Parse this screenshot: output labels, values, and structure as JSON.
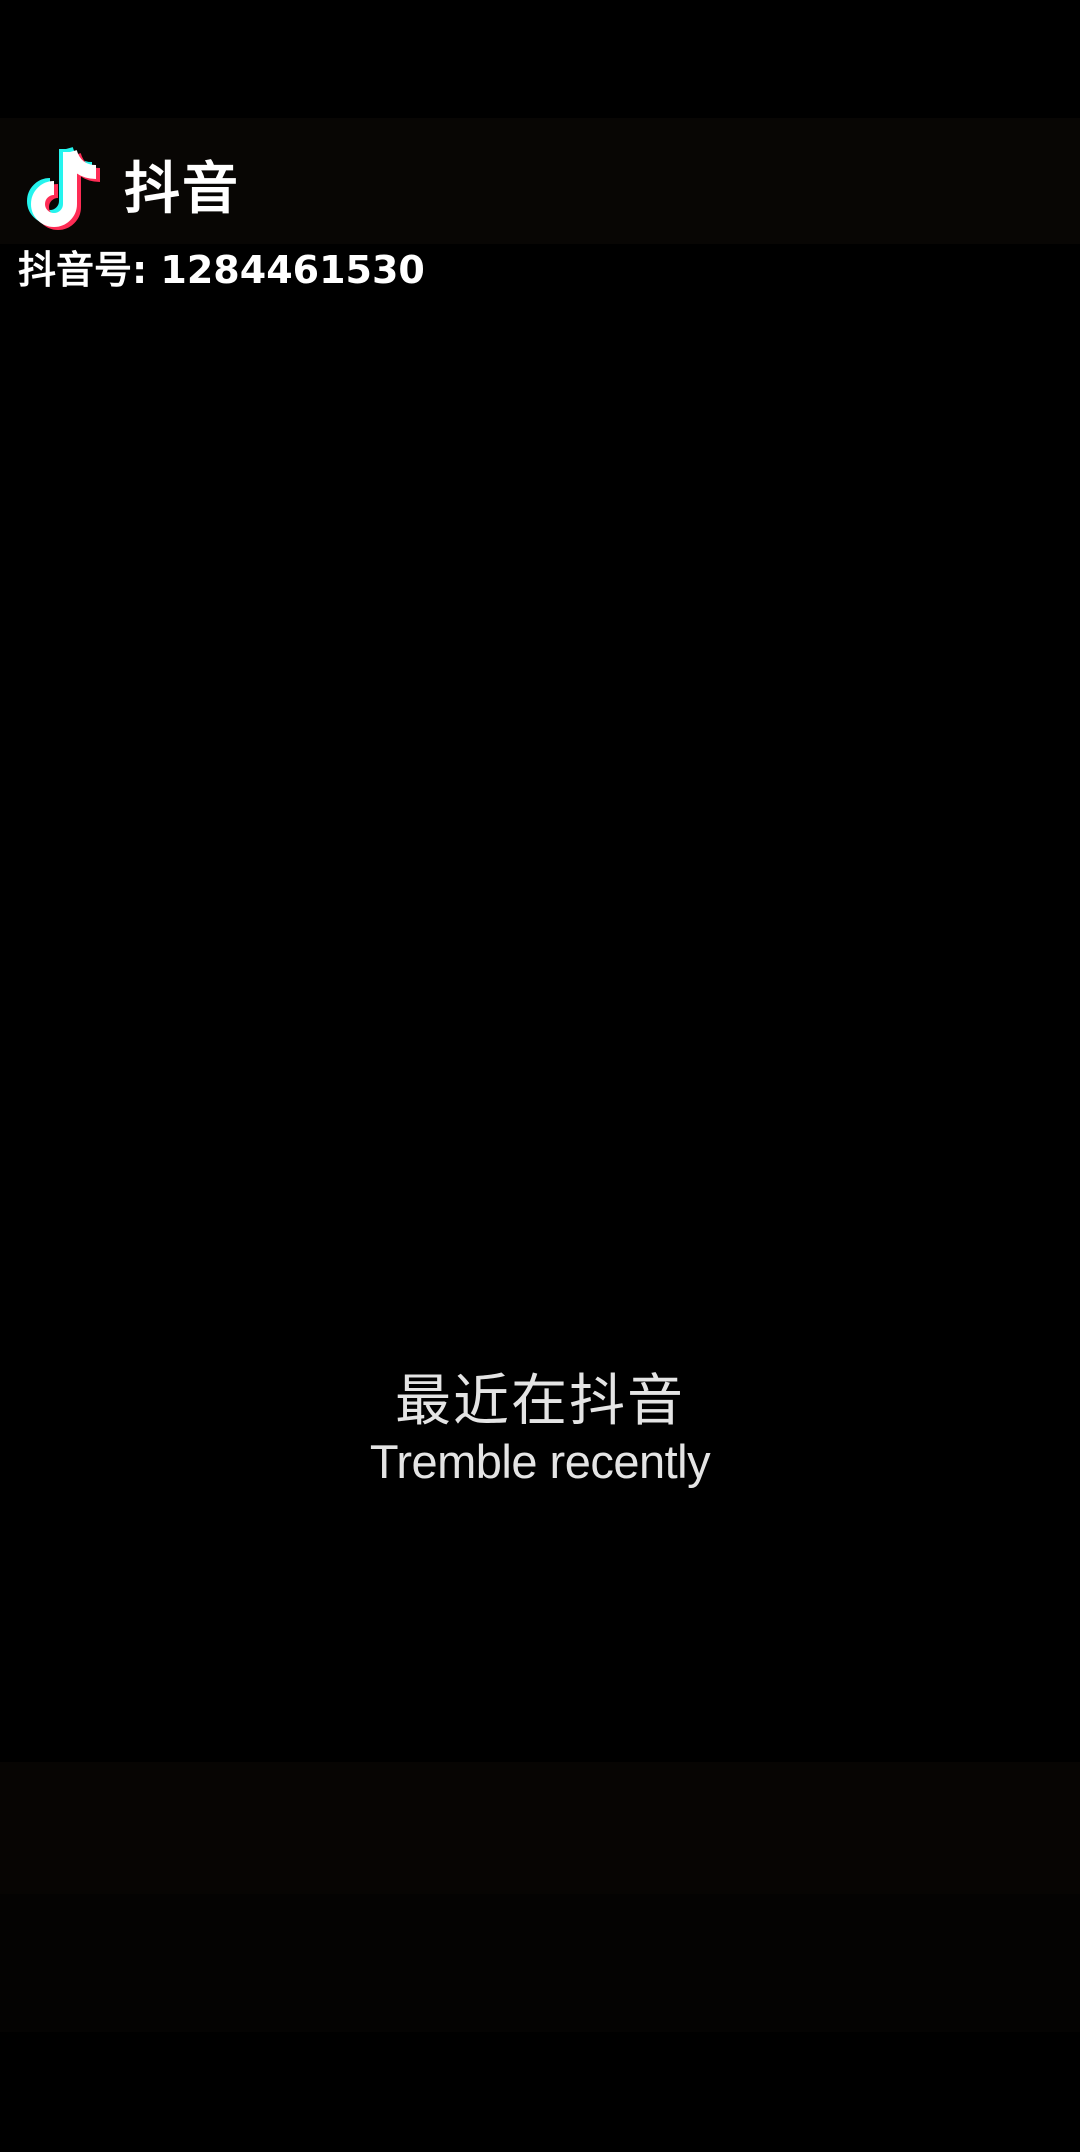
{
  "watermark": {
    "icon": "douyin-note-icon",
    "brand_name": "抖音",
    "account_id": "抖音号: 1284461530"
  },
  "caption": {
    "chinese": "最近在抖音",
    "english": "Tremble recently"
  },
  "colors": {
    "background": "#000000",
    "text": "#ffffff",
    "caption_text": "#e4e4e4",
    "logo_cyan": "#25f4ee",
    "logo_red": "#fe2c55"
  }
}
